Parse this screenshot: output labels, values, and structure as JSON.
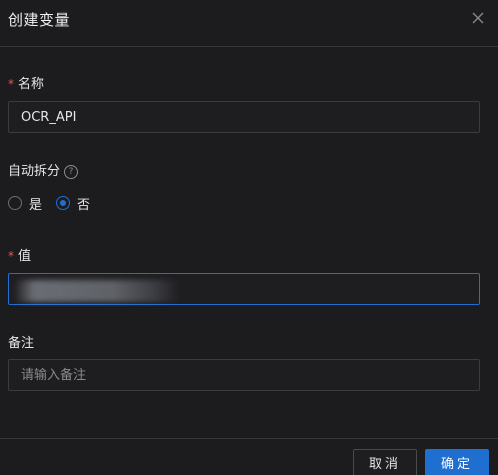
{
  "dialog": {
    "title": "创建变量"
  },
  "form": {
    "name": {
      "required_mark": "*",
      "label": "名称",
      "value": "OCR_API"
    },
    "auto_split": {
      "label": "自动拆分",
      "help_glyph": "?",
      "options": [
        {
          "label": "是",
          "checked": false
        },
        {
          "label": "否",
          "checked": true
        }
      ]
    },
    "value": {
      "required_mark": "*",
      "label": "值"
    },
    "remark": {
      "label": "备注",
      "placeholder": "请输入备注",
      "value": ""
    }
  },
  "footer": {
    "cancel_label": "取消",
    "ok_label": "确定"
  },
  "colors": {
    "accent": "#1f6fd1",
    "required": "#e05a4f",
    "background": "#1c1c1e"
  }
}
